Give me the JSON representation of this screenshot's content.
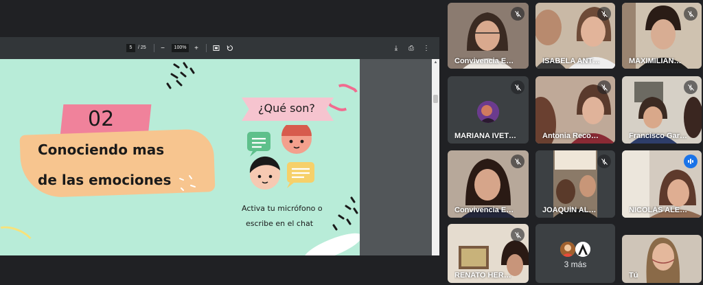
{
  "pdf_toolbar": {
    "page_current": "5",
    "page_total": "/ 25",
    "zoom_out": "−",
    "zoom": "100%",
    "zoom_in": "+",
    "download": "⤓",
    "print": "⎙",
    "more": "⋮"
  },
  "slide": {
    "number": "02",
    "title_line1": "Conociendo mas",
    "title_line2": "de las emociones",
    "question": "¿Qué son?",
    "instruction_line1": "Activa tu micrófono o",
    "instruction_line2": "escribe en el chat"
  },
  "participants": [
    {
      "name": "Convivencia E…",
      "muted": true
    },
    {
      "name": "ISABELA ANT…",
      "muted": true
    },
    {
      "name": "MAXIMILIAN…",
      "muted": true
    },
    {
      "name": "MARIANA IVET…",
      "muted": true
    },
    {
      "name": "Antonia Reco…",
      "muted": true
    },
    {
      "name": "Francisco Gar…",
      "muted": true
    },
    {
      "name": "Convivencia E…",
      "muted": true
    },
    {
      "name": "JOAQUÍN AL…",
      "muted": true
    },
    {
      "name": "NICOLÁS ALE…",
      "muted": false,
      "speaking": true
    },
    {
      "name": "RENATO HER…",
      "muted": true
    },
    {
      "name": "Tú",
      "muted": false
    }
  ],
  "more_tile": {
    "label": "3 más"
  },
  "colors": {
    "accent": "#8ab4f8",
    "speaking": "#1a73e8",
    "background": "#202124"
  }
}
